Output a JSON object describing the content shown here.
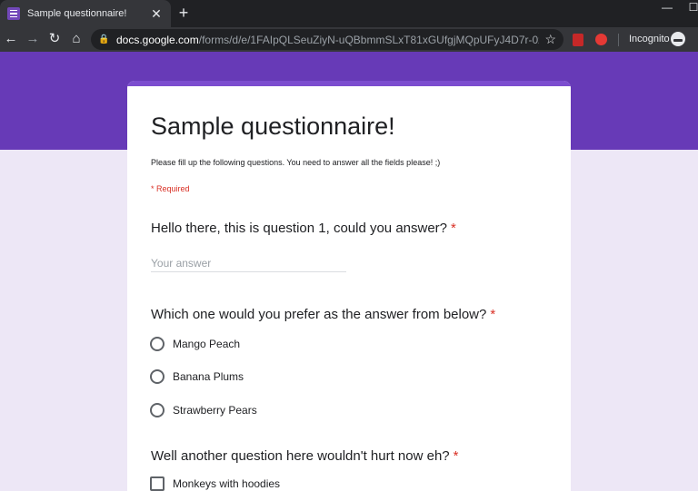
{
  "browser": {
    "tab_title": "Sample questionnaire!",
    "tab_close": "✕",
    "new_tab": "+",
    "minimize": "—",
    "maximize": "☐",
    "close": "✕",
    "url_host": "docs.google.com",
    "url_path": "/forms/d/e/1FAIpQLSeuZiyN-uQBbmmSLxT81xGUfgjMQpUFyJ4D7r-0zjegTy_0H...",
    "incognito_label": "Incognito",
    "icons": [
      "back-icon",
      "forward-icon",
      "reload-icon",
      "home-icon",
      "lock-icon",
      "star-icon",
      "incognito-icon"
    ]
  },
  "form": {
    "title": "Sample questionnaire!",
    "description": "Please fill up the following questions. You need to answer all the fields please! ;)",
    "required_note": "* Required",
    "accent_color": "#673ab7",
    "background_color": "#ede7f6",
    "questions": [
      {
        "title": "Hello there, this is question 1, could you answer?",
        "required_mark": "*",
        "placeholder": "Your answer"
      },
      {
        "title": "Which one would you prefer as the answer from below?",
        "required_mark": "*",
        "options": [
          "Mango Peach",
          "Banana Plums",
          "Strawberry Pears"
        ]
      },
      {
        "title": "Well another question here wouldn't hurt now eh?",
        "required_mark": "*",
        "options": [
          "Monkeys with hoodies"
        ]
      }
    ]
  }
}
